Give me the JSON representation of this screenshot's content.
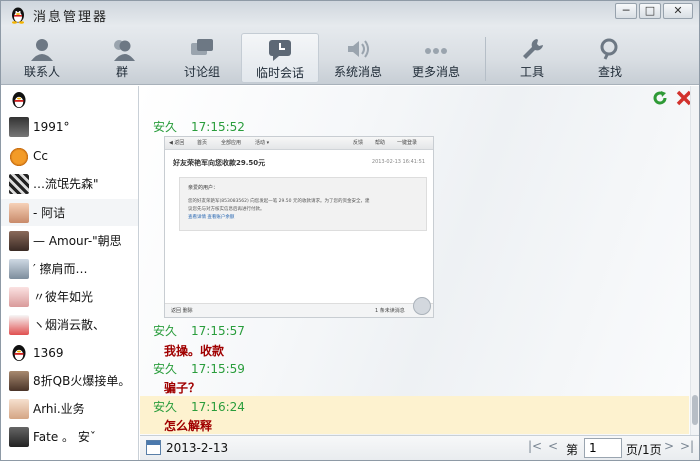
{
  "app": {
    "title": "消息管理器"
  },
  "window_controls": {
    "minimize": "─",
    "maximize": "□",
    "close": "✕"
  },
  "nav": [
    {
      "label": "联系人",
      "icon": "person-icon"
    },
    {
      "label": "群",
      "icon": "group-icon"
    },
    {
      "label": "讨论组",
      "icon": "discussion-icon"
    },
    {
      "label": "临时会话",
      "icon": "temp-chat-icon",
      "active": true
    },
    {
      "label": "系统消息",
      "icon": "speaker-icon"
    },
    {
      "label": "更多消息",
      "icon": "more-icon"
    },
    {
      "label": "工具",
      "icon": "wrench-icon"
    },
    {
      "label": "查找",
      "icon": "search-icon"
    }
  ],
  "contacts": [
    {
      "name": ""
    },
    {
      "name": "           1991°"
    },
    {
      "name": "         Cc"
    },
    {
      "name": "    …流氓先森\""
    },
    {
      "name": "- 阿诘"
    },
    {
      "name": "— Amour-\"朝思"
    },
    {
      "name": "′              擦肩而…"
    },
    {
      "name": "〃彼年如光"
    },
    {
      "name": "ヽ烟消云散、"
    },
    {
      "name": "1369"
    },
    {
      "name": "8折QB火爆接单。"
    },
    {
      "name": "Arhi.业务"
    },
    {
      "name": "Fate 。      安ˇ"
    }
  ],
  "messages": [
    {
      "sender": "安久",
      "time": "17:15:52",
      "text": ""
    },
    {
      "sender": "安久",
      "time": "17:15:57",
      "text": "我操。收款"
    },
    {
      "sender": "安久",
      "time": "17:15:59",
      "text": "骗子？"
    },
    {
      "sender": "安久",
      "time": "17:16:24",
      "text": "怎么解释"
    }
  ],
  "embedded_image": {
    "toolbar": [
      "◀ 返回",
      "首页",
      "全部应用",
      "活动 ▾",
      "反馈",
      "帮助",
      "一键登录"
    ],
    "subject": "好友荣艳军向您收款29.50元",
    "date": "2013-02-13 16:41:51",
    "greeting": "亲爱的用户：",
    "body_line1": "您的好友荣艳军(853083562) 向您发起一笔 29.50 元的收款请求。为了您的资金安全，建",
    "body_line2": "议您先与对方核实信息后再进行付款。",
    "links": "查看详情    查看账户余额",
    "footer_left": "返回    删除",
    "footer_right": "1 条未读消息"
  },
  "bottom": {
    "date": "2013-2-13",
    "page_label_prefix": "第",
    "page_value": "1",
    "page_label_suffix": "页/1页"
  }
}
